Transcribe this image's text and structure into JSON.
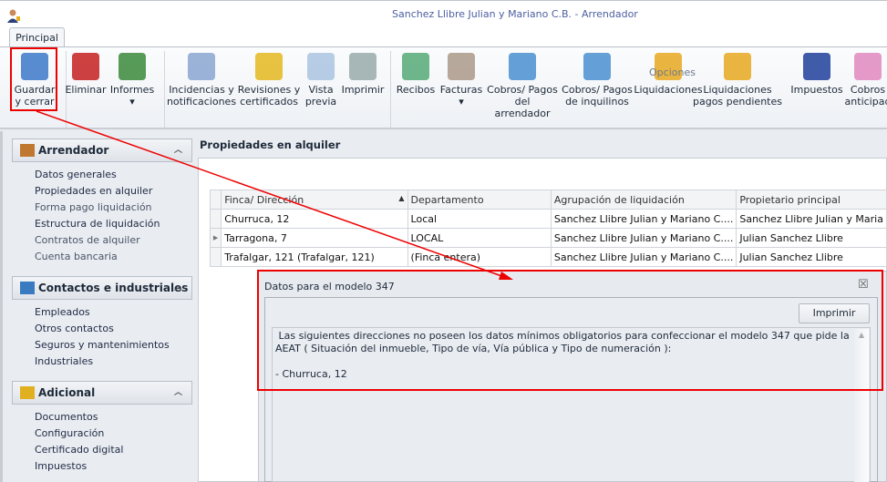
{
  "window": {
    "title": "Sanchez Llibre Julian y Mariano C.B. - Arrendador",
    "tab": "Principal"
  },
  "ribbon": {
    "buttons": [
      {
        "label1": "Guardar",
        "label2": "y cerrar",
        "icon": "save-icon"
      },
      {
        "label1": "Eliminar",
        "label2": "",
        "icon": "delete-icon"
      },
      {
        "label1": "Informes",
        "label2": "▾",
        "icon": "report-icon"
      },
      {
        "label1": "Incidencias y",
        "label2": "notificaciones",
        "icon": "incidents-icon"
      },
      {
        "label1": "Revisiones y",
        "label2": "certificados",
        "icon": "bell-icon"
      },
      {
        "label1": "Vista",
        "label2": "previa",
        "icon": "preview-icon"
      },
      {
        "label1": "Imprimir",
        "label2": "",
        "icon": "printer-icon"
      },
      {
        "label1": "Recibos",
        "label2": "",
        "icon": "receipt-icon"
      },
      {
        "label1": "Facturas",
        "label2": "▾",
        "icon": "invoice-icon"
      },
      {
        "label1": "Cobros/ Pagos",
        "label2": "del arrendador",
        "icon": "calculator-icon"
      },
      {
        "label1": "Cobros/ Pagos",
        "label2": "de inquilinos",
        "icon": "calculator-person-icon"
      },
      {
        "label1": "Liquidaciones",
        "label2": "",
        "icon": "settlement-icon"
      },
      {
        "label1": "Liquidaciones",
        "label2": "pagos pendientes",
        "icon": "settlement-pending-icon"
      },
      {
        "label1": "Impuestos",
        "label2": "",
        "icon": "tax-agency-icon"
      },
      {
        "label1": "Cobros",
        "label2": "anticipad",
        "icon": "piggy-bank-icon"
      }
    ],
    "group_label": "Opciones"
  },
  "sidebar": {
    "groups": [
      {
        "title": "Arrendador",
        "items": [
          "Datos generales",
          "Propiedades en alquiler",
          "Forma pago liquidación",
          "Estructura de liquidación",
          "Contratos de alquiler",
          "Cuenta bancaria"
        ]
      },
      {
        "title": "Contactos e industriales",
        "items": [
          "Empleados",
          "Otros contactos",
          "Seguros y mantenimientos",
          "Industriales"
        ]
      },
      {
        "title": "Adicional",
        "items": [
          "Documentos",
          "Configuración",
          "Certificado digital",
          "Impuestos"
        ]
      }
    ]
  },
  "main": {
    "title": "Propiedades en alquiler",
    "columns": [
      "Finca/ Dirección",
      "Departamento",
      "Agrupación de liquidación",
      "Propietario principal"
    ],
    "rows": [
      [
        "Churruca, 12",
        "Local",
        "Sanchez Llibre Julian y Mariano C....",
        "Sanchez Llibre Julian y Maria"
      ],
      [
        "Tarragona, 7",
        "LOCAL",
        "Sanchez Llibre Julian y Mariano C....",
        "Julian Sanchez Llibre"
      ],
      [
        "Trafalgar, 121 (Trafalgar, 121)",
        "(Finca entera)",
        "Sanchez Llibre Julian y Mariano C....",
        "Julian Sanchez Llibre"
      ]
    ]
  },
  "dialog": {
    "title": "Datos para el modelo 347",
    "print": "Imprimir",
    "text": " Las siguientes direcciones no poseen los datos mínimos obligatorios para confeccionar el modelo 347 que pide la AEAT ( Situación del inmueble, Tipo de vía, Vía pública y Tipo de numeración ):\n\n- Churruca, 12"
  },
  "colors": {
    "highlight": "#e00000",
    "title": "#4d5fa0"
  }
}
